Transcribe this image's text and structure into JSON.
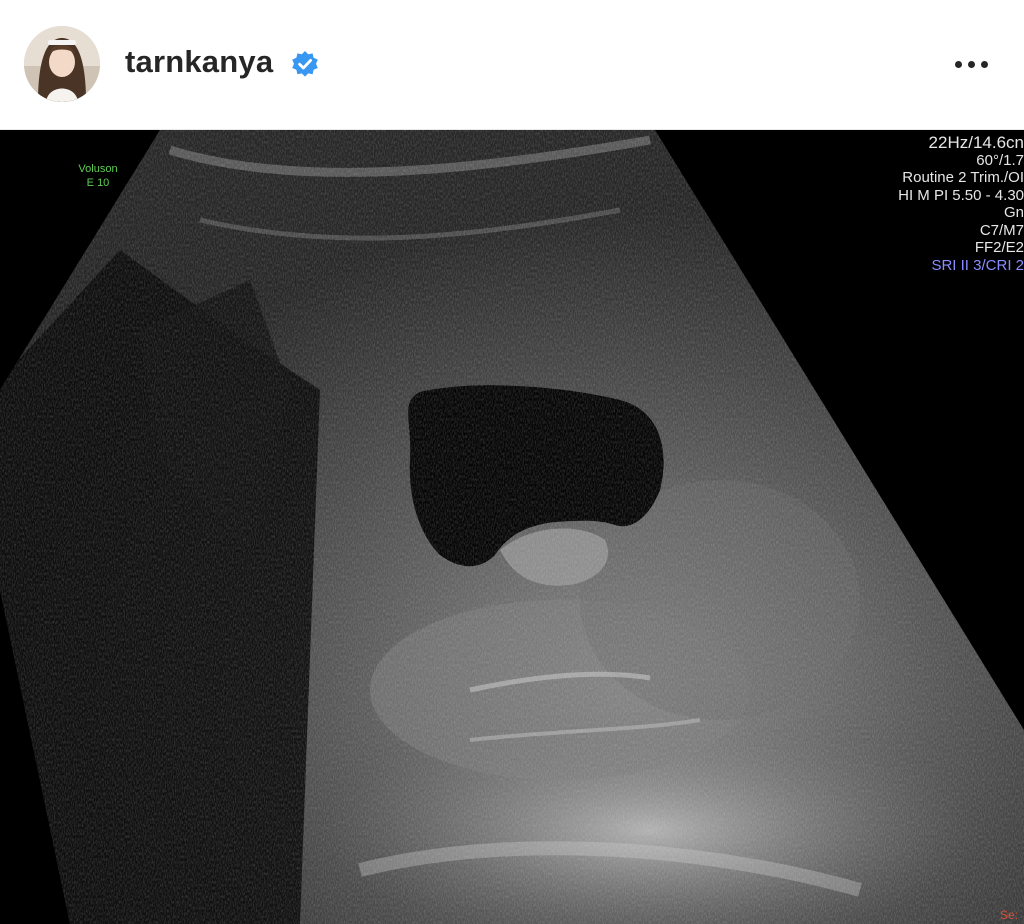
{
  "post_header": {
    "username": "tarnkanya",
    "avatar_icon": "profile-photo",
    "verified_icon": "verified-badge-icon",
    "verified_color": "#3897f0",
    "more_icon": "more-options-icon"
  },
  "ultrasound": {
    "device_brand": "Voluson",
    "device_model": "E 10",
    "params": [
      "22Hz/14.6cn",
      "60°/1.7",
      "Routine 2 Trim./OI",
      "HI M PI 5.50 - 4.30",
      "Gn",
      "C7/M7",
      "FF2/E2",
      "SRI II 3/CRI 2"
    ],
    "corner_text": "Se:",
    "colors": {
      "overlay_text": "#e6e6e6",
      "brand_text": "#5dcf52",
      "sri_text": "#8a8dff",
      "corner_text": "#d8503a"
    }
  }
}
